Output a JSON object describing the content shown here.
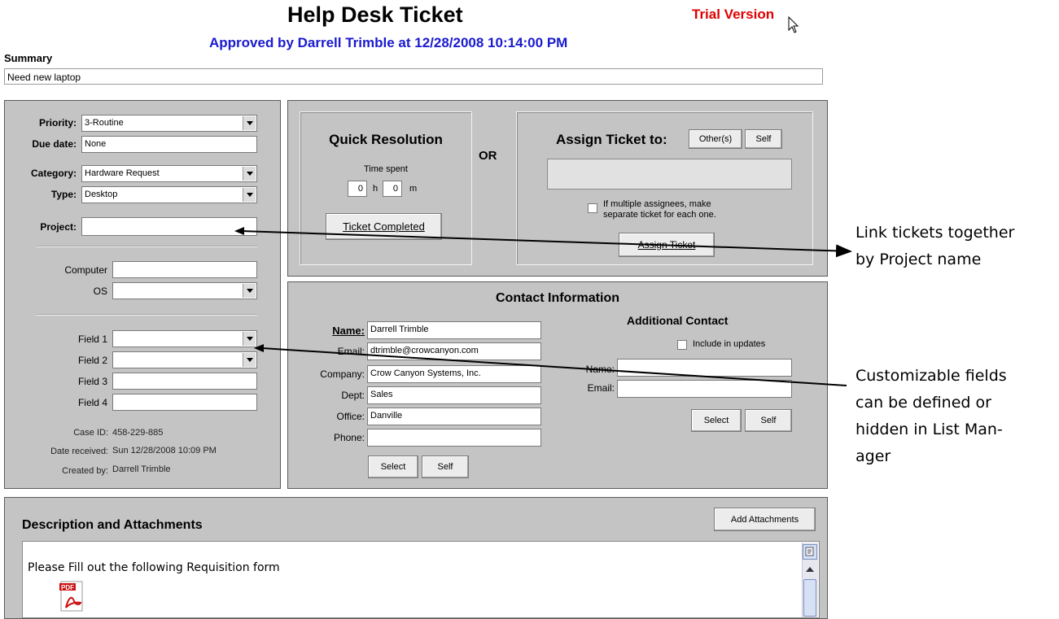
{
  "header": {
    "title": "Help Desk Ticket",
    "trial": "Trial Version",
    "approved": "Approved by Darrell Trimble at 12/28/2008 10:14:00 PM"
  },
  "summary": {
    "label": "Summary",
    "value": "Need new laptop"
  },
  "left": {
    "priority_label": "Priority:",
    "priority_value": "3-Routine",
    "due_label": "Due date:",
    "due_value": "None",
    "category_label": "Category:",
    "category_value": "Hardware Request",
    "type_label": "Type:",
    "type_value": "Desktop",
    "project_label": "Project:",
    "project_value": "",
    "computer_label": "Computer",
    "computer_value": "",
    "os_label": "OS",
    "os_value": "",
    "field1_label": "Field 1",
    "field2_label": "Field 2",
    "field3_label": "Field 3",
    "field4_label": "Field 4",
    "caseid_label": "Case ID:",
    "caseid_value": "458-229-885",
    "received_label": "Date received:",
    "received_value": "Sun 12/28/2008 10:09 PM",
    "created_label": "Created by:",
    "created_value": "Darrell Trimble"
  },
  "quick": {
    "title": "Quick Resolution",
    "time_spent": "Time spent",
    "hours": "0",
    "h": "h",
    "minutes": "0",
    "m": "m",
    "completed_btn": "Ticket Completed"
  },
  "or_label": "OR",
  "assign": {
    "title": "Assign Ticket to:",
    "others_btn": "Other(s)",
    "self_btn": "Self",
    "multi_line1": "If multiple assignees, make",
    "multi_line2": "separate ticket for each one.",
    "assign_btn": "Assign Ticket"
  },
  "contact": {
    "title": "Contact Information",
    "name_label": "Name:",
    "name_value": "Darrell Trimble",
    "email_label": "Email:",
    "email_value": "dtrimble@crowcanyon.com",
    "company_label": "Company:",
    "company_value": "Crow Canyon Systems, Inc.",
    "dept_label": "Dept:",
    "dept_value": "Sales",
    "office_label": "Office:",
    "office_value": "Danville",
    "phone_label": "Phone:",
    "phone_value": "",
    "select_btn": "Select",
    "self_btn": "Self",
    "additional_title": "Additional Contact",
    "include_label": "Include in updates",
    "add_name_label": "Name:",
    "add_email_label": "Email:",
    "add_select_btn": "Select",
    "add_self_btn": "Self"
  },
  "description": {
    "title": "Description and Attachments",
    "add_btn": "Add Attachments",
    "body_text": "Please Fill out the following Requisition form"
  },
  "callouts": {
    "project_line1": "Link tickets together",
    "project_line2": "by Project name",
    "fields_line1": "Customizable fields",
    "fields_line2": "can be defined or",
    "fields_line3": "hidden in List Man-",
    "fields_line4": "ager"
  }
}
